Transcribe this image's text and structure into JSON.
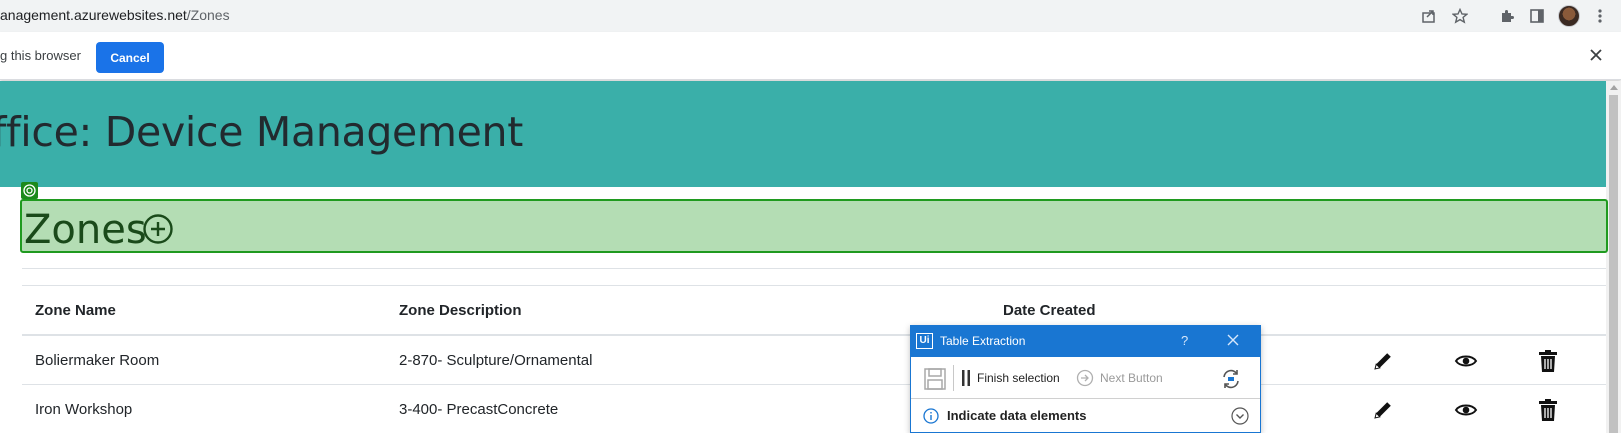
{
  "browser": {
    "url_host": "anagement.azurewebsites.net",
    "url_path": "/Zones",
    "icons": [
      "share-icon",
      "star-icon",
      "extensions-icon",
      "side-panel-icon",
      "profile-avatar",
      "kebab-menu-icon"
    ]
  },
  "infobar": {
    "text": "g this browser",
    "cancel_label": "Cancel",
    "close_icon": "close-icon",
    "button_color": "#1a73e8"
  },
  "page": {
    "banner_title": "ffice: Device Management",
    "banner_color": "#3aafa9",
    "zones_title": "Zones",
    "add_icon": "plus-circle-icon",
    "highlight_color": "#b4ddb4",
    "highlight_border": "#1f9a1f"
  },
  "table": {
    "headers": [
      "Zone Name",
      "Zone Description",
      "Date Created"
    ],
    "rows": [
      {
        "name": "Boliermaker Room",
        "description": "2-870- Sculpture/Ornamental",
        "date": ""
      },
      {
        "name": "Iron Workshop",
        "description": "3-400- PrecastConcrete",
        "date": ""
      }
    ],
    "row_action_icons": [
      "pencil-icon",
      "eye-icon",
      "trash-icon"
    ]
  },
  "dialog": {
    "title": "Table Extraction",
    "logo": "Ui",
    "help": "?",
    "finish_label": "Finish selection",
    "next_label": "Next Button",
    "section_label": "Indicate data elements",
    "title_color": "#1976d2"
  }
}
